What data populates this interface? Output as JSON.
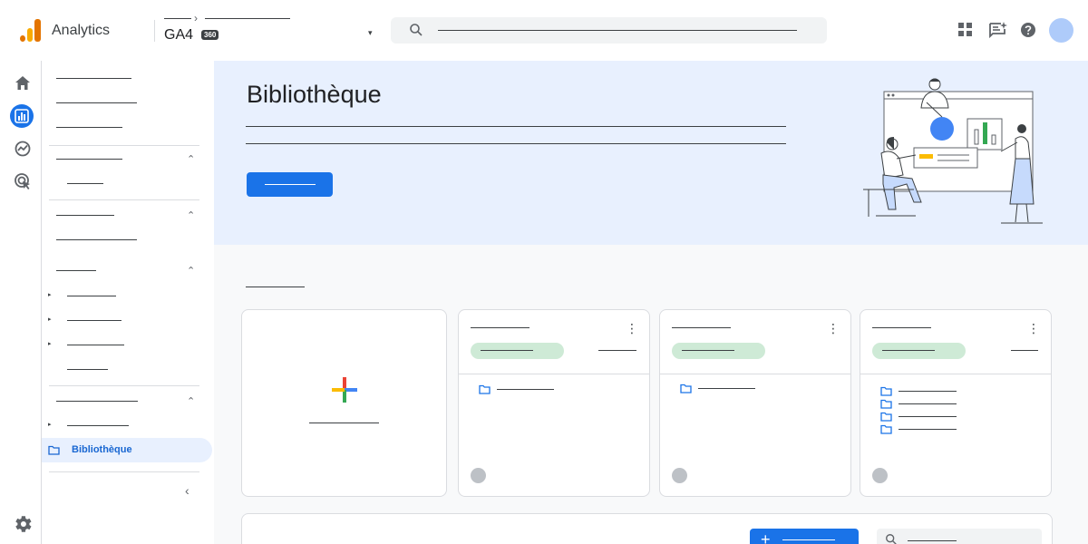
{
  "header": {
    "app_name": "Analytics",
    "property_name": "GA4",
    "property_badge": "360",
    "property_caret": "▾",
    "breadcrumb_separator": "›"
  },
  "icons": {
    "logo": "analytics-logo",
    "search": "search-icon",
    "apps": "apps-grid-icon",
    "feedback": "feedback-icon",
    "help": "help-icon",
    "home": "home-icon",
    "reports": "reports-icon",
    "explore": "explore-icon",
    "advertising": "advertising-icon",
    "settings": "gear-icon",
    "folder": "folder-icon",
    "add": "plus-icon",
    "more": "more-vert-icon"
  },
  "sidebar": {
    "active_item": "Bibliothèque",
    "collapse_glyph": "‹",
    "chevron_glyph": "⌃",
    "expand_glyph": "▸"
  },
  "main": {
    "hero_title": "Bibliothèque",
    "card_menu_glyph": "⋮",
    "create_plus_glyph": "+"
  },
  "colors": {
    "accent": "#1a73e8",
    "hero_bg": "#e8f0fe",
    "active_nav_text": "#1967d2",
    "pill_green": "#ceead6",
    "logo_orange": "#f9ab00",
    "logo_dark_orange": "#e37400"
  }
}
